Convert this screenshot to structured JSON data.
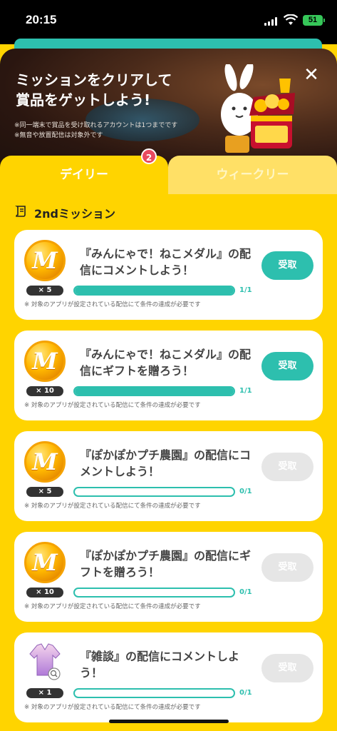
{
  "status": {
    "time": "20:15",
    "battery": "51"
  },
  "banner": {
    "title_line1": "ミッションをクリアして",
    "title_line2": "賞品をゲットしよう!",
    "note1": "※同一端末で賞品を受け取れるアカウントは1つまでです",
    "note2": "※無音や放置配信は対象外です",
    "close": "✕"
  },
  "tabs": {
    "daily": "デイリー",
    "weekly": "ウィークリー",
    "badge": "2"
  },
  "section": {
    "title": "2ndミッション"
  },
  "missions": [
    {
      "title": "『みんにゃで！ねこメダル』の配信にコメントしよう！",
      "qty": "× 5",
      "progress": "1/1",
      "progress_fraction": 1.0,
      "claim": "受取",
      "claimable": true,
      "note": "※ 対象のアプリが設定されている配信にて条件の達成が必要です",
      "icon": "medal-coin-icon"
    },
    {
      "title": "『みんにゃで！ねこメダル』の配信にギフトを贈ろう！",
      "qty": "× 10",
      "progress": "1/1",
      "progress_fraction": 1.0,
      "claim": "受取",
      "claimable": true,
      "note": "※ 対象のアプリが設定されている配信にて条件の達成が必要です",
      "icon": "medal-coin-icon"
    },
    {
      "title": "『ぽかぽかプチ農園』の配信にコメントしよう！",
      "qty": "× 5",
      "progress": "0/1",
      "progress_fraction": 0.0,
      "claim": "受取",
      "claimable": false,
      "note": "※ 対象のアプリが設定されている配信にて条件の達成が必要です",
      "icon": "medal-coin-icon"
    },
    {
      "title": "『ぽかぽかプチ農園』の配信にギフトを贈ろう！",
      "qty": "× 10",
      "progress": "0/1",
      "progress_fraction": 0.0,
      "claim": "受取",
      "claimable": false,
      "note": "※ 対象のアプリが設定されている配信にて条件の達成が必要です",
      "icon": "medal-coin-icon"
    },
    {
      "title": "『雑談』の配信にコメントしよう！",
      "qty": "× 1",
      "progress": "0/1",
      "progress_fraction": 0.0,
      "claim": "受取",
      "claimable": false,
      "note": "※ 対象のアプリが設定されている配信にて条件の達成が必要です",
      "icon": "shirt-item-icon"
    }
  ],
  "colors": {
    "accent": "#2dbfae",
    "background": "#FFD400",
    "badge": "#e84a5f"
  }
}
